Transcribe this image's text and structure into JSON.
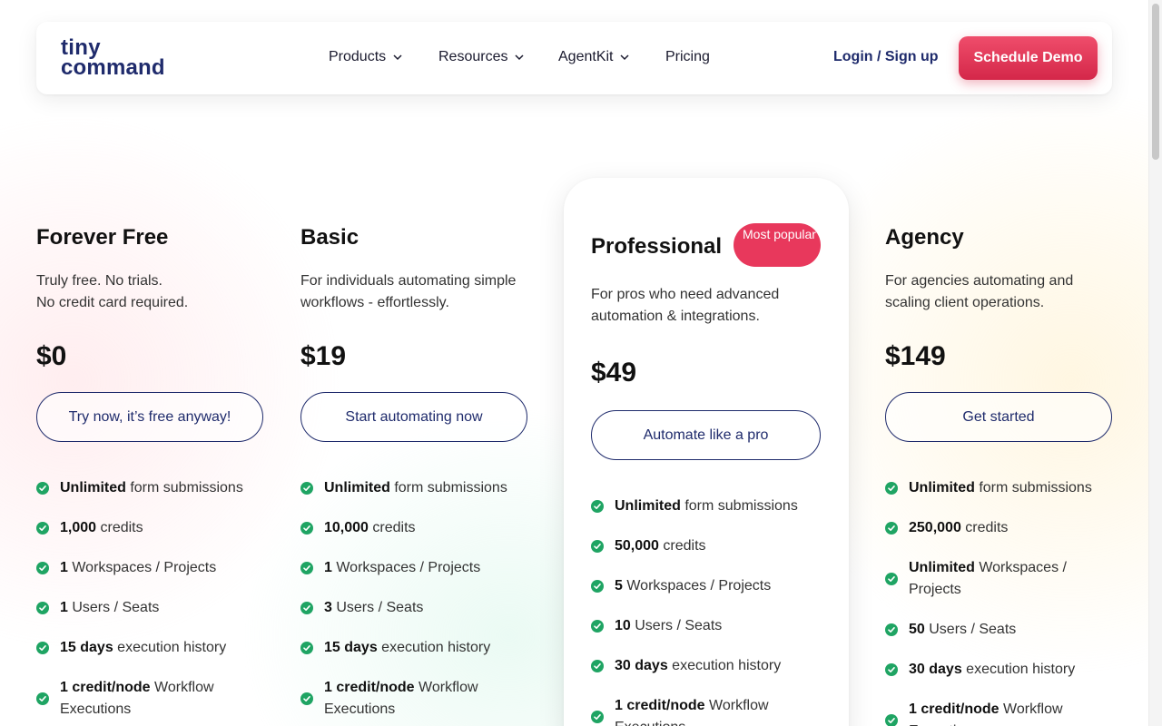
{
  "nav": {
    "logo_line1": "tiny",
    "logo_line2": "command",
    "menu": [
      {
        "label": "Products",
        "has_dropdown": true
      },
      {
        "label": "Resources",
        "has_dropdown": true
      },
      {
        "label": "AgentKit",
        "has_dropdown": true
      },
      {
        "label": "Pricing",
        "has_dropdown": false
      }
    ],
    "login_label": "Login / Sign up",
    "demo_label": "Schedule Demo"
  },
  "colors": {
    "brand_navy": "#1f2b6c",
    "accent_red": "#e8385c",
    "check_green": "#1fa463"
  },
  "plans": [
    {
      "name": "Forever Free",
      "description_lines": [
        "Truly free. No trials.",
        "No credit card required."
      ],
      "price": "$0",
      "cta": "Try now, it’s free anyway!",
      "features": [
        {
          "bold": "Unlimited",
          "rest": " form submissions"
        },
        {
          "bold": "1,000",
          "rest": " credits"
        },
        {
          "bold": "1",
          "rest": " Workspaces / Projects"
        },
        {
          "bold": "1",
          "rest": " Users / Seats"
        },
        {
          "bold": "15 days",
          "rest": " execution history"
        },
        {
          "bold": "1 credit/node",
          "rest": " Workflow Executions"
        }
      ]
    },
    {
      "name": "Basic",
      "description_lines": [
        "For individuals automating simple",
        "workflows - effortlessly."
      ],
      "price": "$19",
      "cta": "Start automating now",
      "features": [
        {
          "bold": "Unlimited",
          "rest": " form submissions"
        },
        {
          "bold": "10,000",
          "rest": " credits"
        },
        {
          "bold": "1",
          "rest": " Workspaces / Projects"
        },
        {
          "bold": "3",
          "rest": " Users / Seats"
        },
        {
          "bold": "15 days",
          "rest": " execution history"
        },
        {
          "bold": "1 credit/node",
          "rest": " Workflow Executions"
        }
      ]
    },
    {
      "name": "Professional",
      "badge": "Most popular",
      "description_lines": [
        "For pros who need advanced",
        "automation & integrations."
      ],
      "price": "$49",
      "cta": "Automate like a pro",
      "features": [
        {
          "bold": "Unlimited",
          "rest": " form submissions"
        },
        {
          "bold": "50,000",
          "rest": " credits"
        },
        {
          "bold": "5",
          "rest": " Workspaces / Projects"
        },
        {
          "bold": "10",
          "rest": " Users / Seats"
        },
        {
          "bold": "30 days",
          "rest": " execution history"
        },
        {
          "bold": "1 credit/node",
          "rest": " Workflow Executions"
        }
      ]
    },
    {
      "name": "Agency",
      "description_lines": [
        "For agencies automating and",
        "scaling client operations."
      ],
      "price": "$149",
      "cta": "Get started",
      "features": [
        {
          "bold": "Unlimited",
          "rest": " form submissions"
        },
        {
          "bold": "250,000",
          "rest": " credits"
        },
        {
          "bold": "Unlimited",
          "rest": " Workspaces / Projects"
        },
        {
          "bold": "50",
          "rest": " Users / Seats"
        },
        {
          "bold": "30 days",
          "rest": " execution history"
        },
        {
          "bold": "1 credit/node",
          "rest": " Workflow Executions"
        }
      ]
    }
  ]
}
